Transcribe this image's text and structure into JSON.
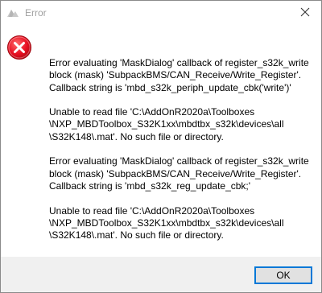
{
  "window": {
    "title": "Error",
    "close_icon": "close-icon",
    "app_icon": "matlab-error-icon"
  },
  "dialog": {
    "icon": "error-icon",
    "icon_color": "#e81123",
    "paragraphs": [
      [
        "Error evaluating 'MaskDialog' callback of register_s32k_write",
        "block (mask) 'SubpackBMS/CAN_Receive/Write_Register'.",
        "Callback string is 'mbd_s32k_periph_update_cbk('write')'"
      ],
      [
        "Unable to read file 'C:\\AddOnR2020a\\Toolboxes",
        "\\NXP_MBDToolbox_S32K1xx\\mbdtbx_s32k\\devices\\all",
        "\\S32K148\\.mat'. No such file or directory."
      ],
      [
        "Error evaluating 'MaskDialog' callback of register_s32k_write",
        "block (mask) 'SubpackBMS/CAN_Receive/Write_Register'.",
        "Callback string is 'mbd_s32k_reg_update_cbk;'"
      ],
      [
        "Unable to read file 'C:\\AddOnR2020a\\Toolboxes",
        "\\NXP_MBDToolbox_S32K1xx\\mbdtbx_s32k\\devices\\all",
        "\\S32K148\\.mat'. No such file or directory."
      ]
    ]
  },
  "footer": {
    "ok_label": "OK",
    "accent": "#0078d7"
  }
}
